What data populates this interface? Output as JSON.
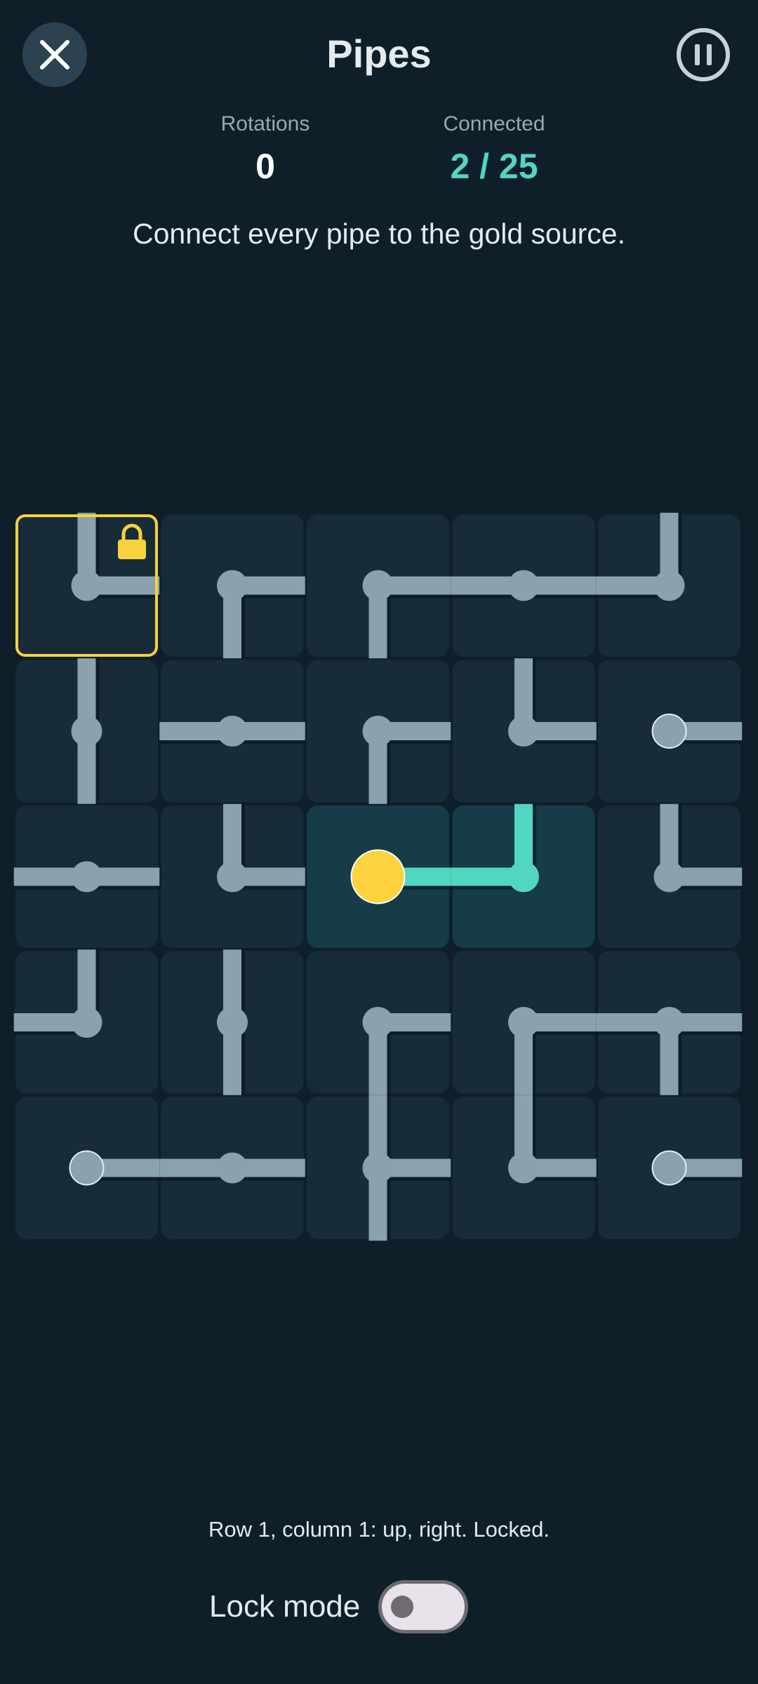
{
  "header": {
    "title": "Pipes",
    "close_icon": "close-icon",
    "pause_icon": "pause-icon"
  },
  "stats": {
    "rotations_label": "Rotations",
    "rotations_value": "0",
    "connected_label": "Connected",
    "connected_value": "2 / 25"
  },
  "instructions": "Connect every pipe to the gold source.",
  "colors": {
    "background": "#0f1f29",
    "tile": "#172c38",
    "tile_connected": "#153c47",
    "pipe": "#8aa1ae",
    "pipe_connected": "#52d6c4",
    "source": "#fed33f",
    "selection": "#f6d23e"
  },
  "board": {
    "rows": 5,
    "cols": 5,
    "selected": {
      "row": 1,
      "col": 1
    },
    "tiles": [
      [
        {
          "conn": [
            "up",
            "right"
          ],
          "connected": false,
          "locked": true
        },
        {
          "conn": [
            "right",
            "down"
          ],
          "connected": false
        },
        {
          "conn": [
            "right",
            "down"
          ],
          "connected": false
        },
        {
          "conn": [
            "left",
            "right"
          ],
          "connected": false
        },
        {
          "conn": [
            "up",
            "left"
          ],
          "connected": false
        }
      ],
      [
        {
          "conn": [
            "up",
            "down"
          ],
          "connected": false
        },
        {
          "conn": [
            "left",
            "right"
          ],
          "connected": false
        },
        {
          "conn": [
            "right",
            "down"
          ],
          "connected": false
        },
        {
          "conn": [
            "up",
            "right"
          ],
          "connected": false
        },
        {
          "conn": [
            "right"
          ],
          "connected": false,
          "end": true
        }
      ],
      [
        {
          "conn": [
            "left",
            "right"
          ],
          "connected": false
        },
        {
          "conn": [
            "up",
            "right"
          ],
          "connected": false
        },
        {
          "conn": [
            "right"
          ],
          "connected": true,
          "source": true
        },
        {
          "conn": [
            "up",
            "left"
          ],
          "connected": true
        },
        {
          "conn": [
            "up",
            "right"
          ],
          "connected": false
        }
      ],
      [
        {
          "conn": [
            "up",
            "left"
          ],
          "connected": false
        },
        {
          "conn": [
            "up",
            "down"
          ],
          "connected": false
        },
        {
          "conn": [
            "right",
            "down"
          ],
          "connected": false
        },
        {
          "conn": [
            "right",
            "down"
          ],
          "connected": false
        },
        {
          "conn": [
            "left",
            "right",
            "down"
          ],
          "connected": false
        }
      ],
      [
        {
          "conn": [
            "right"
          ],
          "connected": false,
          "end": true
        },
        {
          "conn": [
            "left",
            "right"
          ],
          "connected": false
        },
        {
          "conn": [
            "up",
            "right",
            "down"
          ],
          "connected": false
        },
        {
          "conn": [
            "up",
            "right"
          ],
          "connected": false
        },
        {
          "conn": [
            "right"
          ],
          "connected": false,
          "end": true
        }
      ]
    ]
  },
  "status_text": "Row 1, column 1: up, right. Locked.",
  "lock_mode": {
    "label": "Lock mode",
    "on": false
  }
}
